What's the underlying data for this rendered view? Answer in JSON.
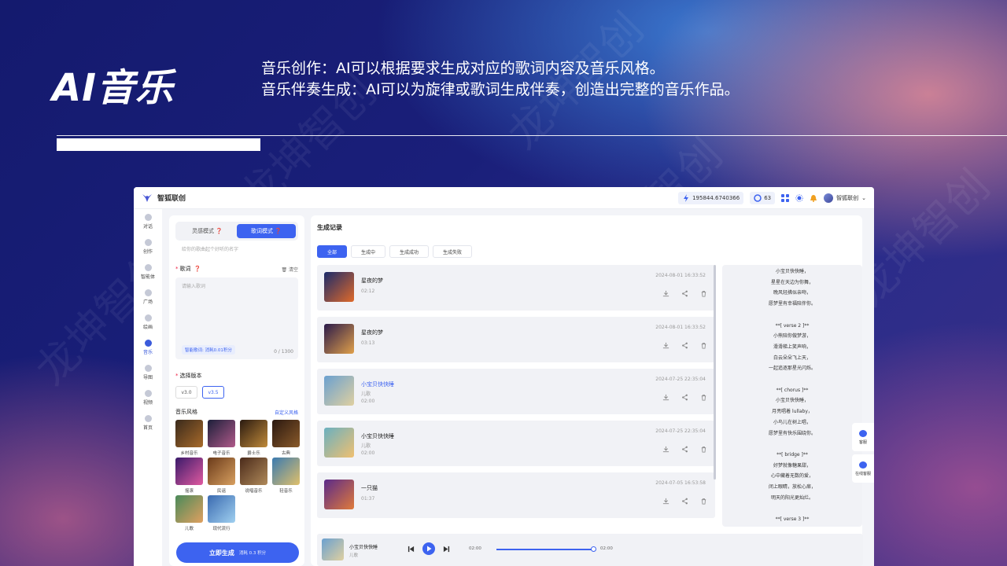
{
  "hero": {
    "title": "AI音乐",
    "desc_line1": "音乐创作：AI可以根据要求生成对应的歌词内容及音乐风格。",
    "desc_line2": "音乐伴奏生成：AI可以为旋律或歌词生成伴奏，创造出完整的音乐作品。"
  },
  "app": {
    "name": "智狐联创",
    "points": "195844.6740366",
    "coins": "63",
    "user_name": "智狐联创"
  },
  "sidebar": {
    "items": [
      {
        "label": "对话",
        "icon": "chat-icon"
      },
      {
        "label": "创作",
        "icon": "pen-icon"
      },
      {
        "label": "智能体",
        "icon": "agent-icon"
      },
      {
        "label": "广场",
        "icon": "grid-icon"
      },
      {
        "label": "绘画",
        "icon": "paint-icon"
      },
      {
        "label": "音乐",
        "icon": "music-icon"
      },
      {
        "label": "导图",
        "icon": "mindmap-icon"
      },
      {
        "label": "视频",
        "icon": "video-icon"
      },
      {
        "label": "首页",
        "icon": "home-icon"
      }
    ],
    "active_index": 5
  },
  "left": {
    "mode_inspire": "灵感模式",
    "mode_lyrics": "歌词模式",
    "name_hint": "给你的歌曲起个好听的名字",
    "lyrics_label": "歌词",
    "clear": "清空",
    "lyrics_placeholder": "请输入歌词",
    "smart_lyrics": "智能歌词: 消耗0.01积分",
    "char_count": "0 / 1300",
    "version_label": "选择版本",
    "versions": [
      "v3.0",
      "v3.5"
    ],
    "style_label": "音乐风格",
    "custom_style": "自定义风格",
    "styles": [
      {
        "label": "乡村音乐",
        "c1": "#3a2a1c",
        "c2": "#a86a2a"
      },
      {
        "label": "电子音乐",
        "c1": "#1c1f3a",
        "c2": "#b05a8a"
      },
      {
        "label": "爵士乐",
        "c1": "#2a1a10",
        "c2": "#c08a3a"
      },
      {
        "label": "古典",
        "c1": "#2a1810",
        "c2": "#8a5a2a"
      },
      {
        "label": "摇滚",
        "c1": "#3a1a6a",
        "c2": "#e05aa0"
      },
      {
        "label": "民谣",
        "c1": "#6a3a1a",
        "c2": "#d8a060"
      },
      {
        "label": "说唱音乐",
        "c1": "#4a2a1a",
        "c2": "#b08a5a"
      },
      {
        "label": "轻音乐",
        "c1": "#3a7ab0",
        "c2": "#e0c06a"
      },
      {
        "label": "儿歌",
        "c1": "#4a8a5a",
        "c2": "#e0a060"
      },
      {
        "label": "现代流行",
        "c1": "#3a6ab0",
        "c2": "#a0d0f0"
      }
    ],
    "generate_label": "立即生成",
    "generate_cost": "消耗 0.3 积分"
  },
  "main": {
    "title": "生成记录",
    "filters": [
      "全部",
      "生成中",
      "生成成功",
      "生成失败"
    ],
    "records": [
      {
        "title": "星夜的梦",
        "sub": "",
        "dur": "02:12",
        "time": "2024-08-01 16:33:52",
        "c1": "#1a2a6a",
        "c2": "#e06a2a"
      },
      {
        "title": "星夜的梦",
        "sub": "",
        "dur": "03:13",
        "time": "2024-08-01 16:33:52",
        "c1": "#2a1a4a",
        "c2": "#e0a04a"
      },
      {
        "title": "小宝贝快快睡",
        "sub": "儿歌",
        "dur": "02:00",
        "time": "2024-07-25 22:35:04",
        "c1": "#6aa0d0",
        "c2": "#e0d0a0"
      },
      {
        "title": "小宝贝快快睡",
        "sub": "儿歌",
        "dur": "02:00",
        "time": "2024-07-25 22:35:04",
        "c1": "#6ab0c0",
        "c2": "#f0c070"
      },
      {
        "title": "一只猫",
        "sub": "",
        "dur": "01:37",
        "time": "2024-07-05 16:53:58",
        "c1": "#5a2a8a",
        "c2": "#e07a3a"
      }
    ],
    "lyrics_lines": [
      "小宝贝快快睡，",
      "星星在天边为你舞，",
      "晚风轻拂似亲吻，",
      "愿梦里有幸福陪伴你。",
      "",
      "**[ verse 2 ]**",
      "小熊陪你做梦游，",
      "滑滑梯上笑声响，",
      "白云朵朵飞上天，",
      "一起追逐那星光闪烁。",
      "",
      "**[ chorus ]**",
      "小宝贝快快睡，",
      "月亮唱着 lullaby，",
      "小鸟儿在树上唱，",
      "愿梦里有快乐围绕你。",
      "",
      "**[ bridge ]**",
      "好梦就像糖果甜，",
      "心中藏着无数的爱，",
      "闭上眼睛，放松心扉，",
      "明天的阳光更灿烂。",
      "",
      "**[ verse 3 ]**"
    ],
    "player": {
      "title": "小宝贝快快睡",
      "sub": "儿歌",
      "current": "02:00",
      "total": "02:00",
      "progress": 1.0
    }
  },
  "float": {
    "service": "客服",
    "online": "在线客服"
  },
  "colors": {
    "accent": "#3d63f0"
  }
}
